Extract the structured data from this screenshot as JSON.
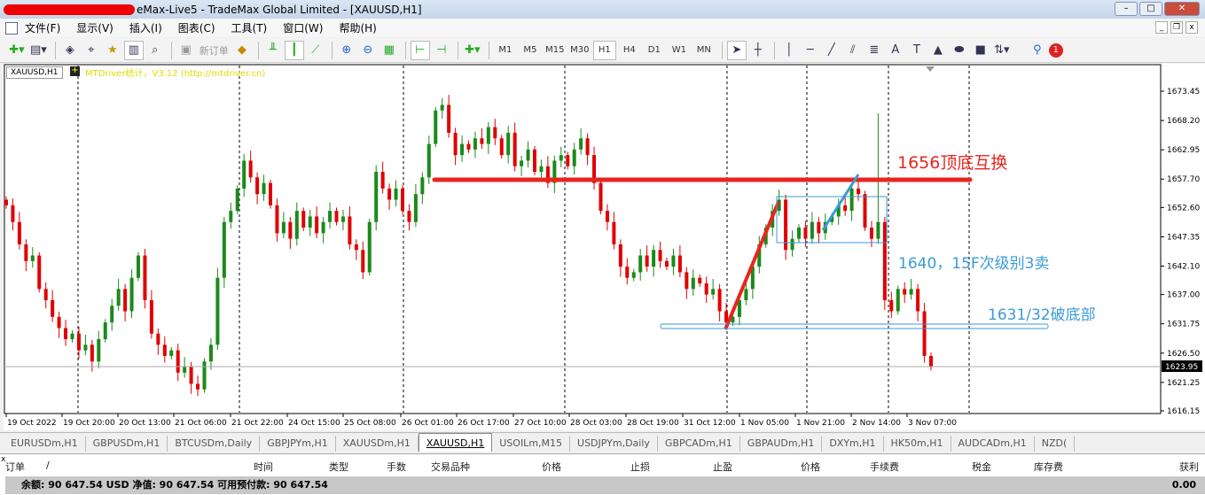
{
  "window": {
    "title": "eMax-Live5 - TradeMax Global Limited - [XAUUSD,H1]",
    "buttons": [
      "–",
      "□",
      "✕"
    ]
  },
  "menu": [
    "文件(F)",
    "显示(V)",
    "插入(I)",
    "图表(C)",
    "工具(T)",
    "窗口(W)",
    "帮助(H)"
  ],
  "toolbar": {
    "new_order": "新订单",
    "timeframes": [
      "M1",
      "M5",
      "M15",
      "M30",
      "H1",
      "H4",
      "D1",
      "W1",
      "MN"
    ],
    "active_timeframe": "H1",
    "notification_count": "1"
  },
  "chart": {
    "symbol_label": "XAUUSD,H1",
    "indicator_label": "MTDriver统计，V3.12 (http://mtdriver.cn)",
    "price_ticks": [
      "1673.45",
      "1668.20",
      "1662.95",
      "1657.70",
      "1652.60",
      "1647.35",
      "1642.10",
      "1637.00",
      "1631.75",
      "1626.50",
      "1621.25",
      "1616.15"
    ],
    "current_price": "1623.95",
    "time_labels": [
      "19 Oct 2022",
      "19 Oct 20:00",
      "20 Oct 13:00",
      "21 Oct 06:00",
      "21 Oct 22:00",
      "24 Oct 15:00",
      "25 Oct 08:00",
      "26 Oct 01:00",
      "26 Oct 17:00",
      "27 Oct 10:00",
      "28 Oct 03:00",
      "28 Oct 19:00",
      "31 Oct 12:00",
      "1 Nov 05:00",
      "1 Nov 21:00",
      "2 Nov 14:00",
      "3 Nov 07:00"
    ],
    "annotations": {
      "resistance": "1656顶底互换",
      "sell": "1640，15F次级别3卖",
      "break": "1631/32破底部"
    },
    "colors": {
      "bull": "#1a8a1a",
      "bear": "#e00000",
      "red_annot": "#e8251c",
      "blue_annot": "#3a9ad9"
    }
  },
  "chart_data": {
    "type": "candlestick",
    "timeframe": "H1",
    "ylim": [
      1616.15,
      1675.5
    ],
    "closes": [
      1653,
      1650,
      1646,
      1643,
      1644,
      1638,
      1636,
      1633,
      1631,
      1629,
      1630,
      1627,
      1628,
      1625,
      1629,
      1632,
      1635,
      1638,
      1634,
      1640,
      1644,
      1636,
      1630,
      1628,
      1626,
      1627,
      1623,
      1624,
      1621,
      1620,
      1625,
      1628,
      1640,
      1650,
      1652,
      1656,
      1661,
      1658,
      1655,
      1657,
      1653,
      1648,
      1650,
      1647,
      1652,
      1649,
      1651,
      1648,
      1650,
      1652,
      1650,
      1651,
      1646,
      1645,
      1641,
      1650,
      1659,
      1656,
      1654,
      1656,
      1652,
      1650,
      1655,
      1658,
      1664,
      1670,
      1671,
      1666,
      1662,
      1664,
      1663,
      1665,
      1664,
      1667,
      1665,
      1662,
      1666,
      1660,
      1661,
      1663,
      1659,
      1660,
      1657,
      1661,
      1662,
      1660,
      1663,
      1665,
      1662,
      1657,
      1652,
      1650,
      1646,
      1642,
      1640,
      1641,
      1644,
      1642,
      1645,
      1643,
      1642,
      1644,
      1641,
      1638,
      1640,
      1639,
      1637,
      1638,
      1634,
      1632,
      1633,
      1636,
      1638,
      1642,
      1646,
      1649,
      1652,
      1654,
      1645,
      1647,
      1649,
      1647,
      1650,
      1648,
      1650,
      1651,
      1653,
      1652,
      1656,
      1655,
      1649,
      1647,
      1650,
      1636,
      1634,
      1638,
      1637,
      1638,
      1634,
      1626,
      1624
    ],
    "spike_high": 1669.5
  },
  "tabs": [
    "EURUSDm,H1",
    "GBPUSDm,H1",
    "BTCUSDm,Daily",
    "GBPJPYm,H1",
    "XAUUSDm,H1",
    "XAUUSD,H1",
    "USOILm,M15",
    "USDJPYm,Daily",
    "GBPCADm,H1",
    "GBPAUDm,H1",
    "DXYm,H1",
    "HK50m,H1",
    "AUDCADm,H1",
    "NZD("
  ],
  "active_tab": "XAUUSD,H1",
  "terminal": {
    "columns": [
      "订单",
      "/",
      "时间",
      "类型",
      "手数",
      "交易品种",
      "价格",
      "止损",
      "止盈",
      "价格",
      "手续费",
      "税金",
      "库存费",
      "获利"
    ],
    "balance": "余额: 90 647.54 USD  净值: 90 647.54  可用预付款: 90 647.54",
    "profit": "0.00"
  }
}
